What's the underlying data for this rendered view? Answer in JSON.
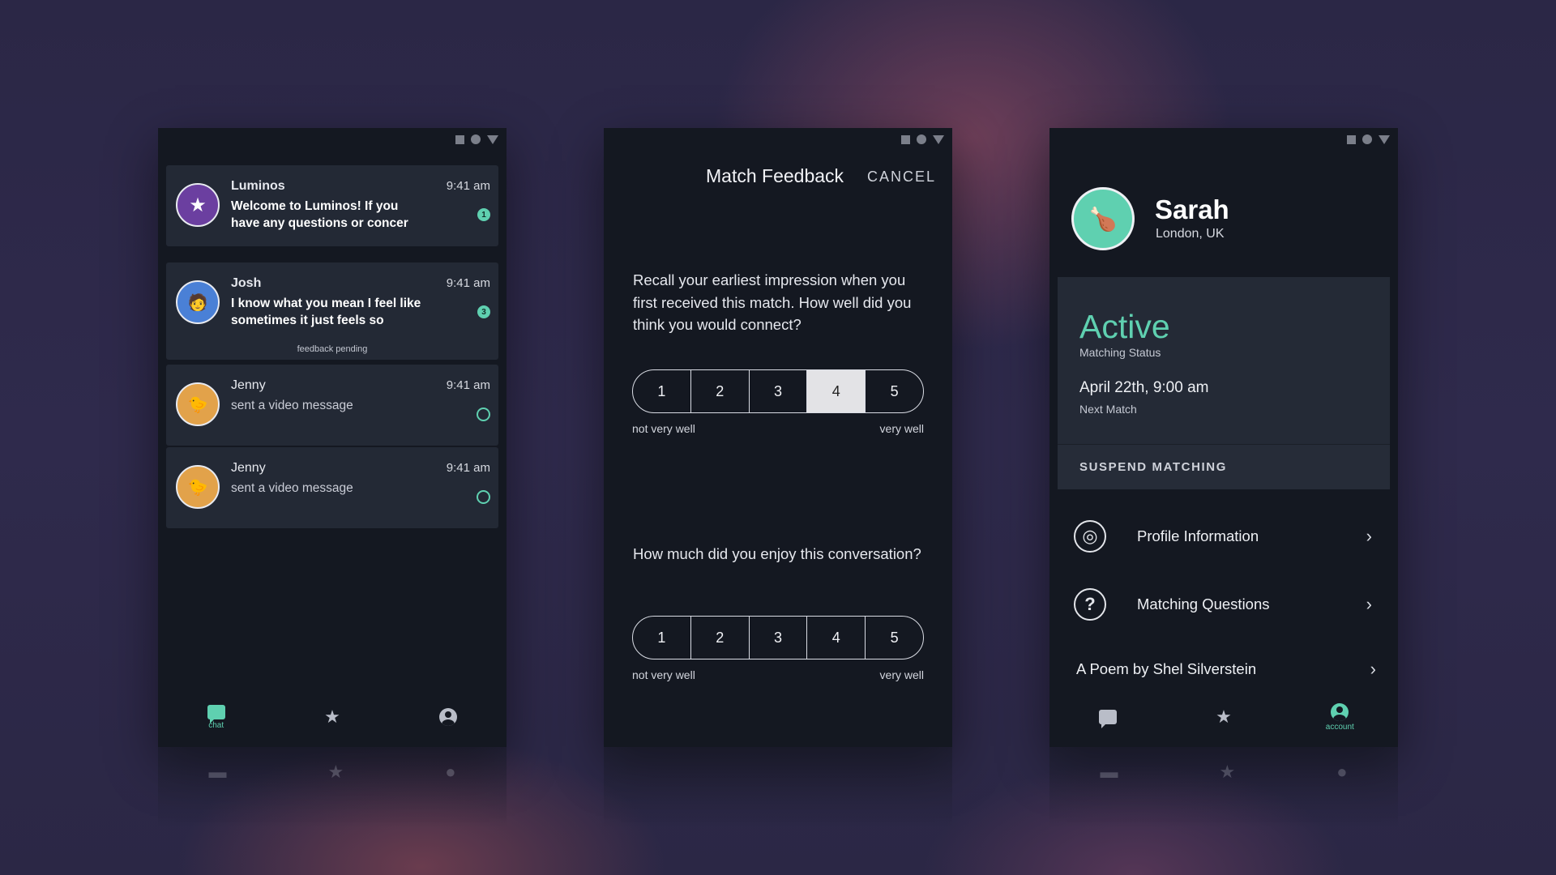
{
  "status_icons": [
    "square-icon",
    "circle-icon",
    "triangle-icon"
  ],
  "colors": {
    "accent": "#5fd0b0",
    "panel": "#141821",
    "card": "#232935",
    "background": "#2d2948"
  },
  "chat_screen": {
    "conversations": [
      {
        "name": "Luminos",
        "time": "9:41 am",
        "message": "Welcome to Luminos! If you have any questions or concer",
        "unread": "1",
        "avatar_icon": "star-icon"
      },
      {
        "name": "Josh",
        "time": "9:41 am",
        "message": "I know what you mean I feel like sometimes it just feels so",
        "unread": "3",
        "footer": "feedback pending",
        "avatar_icon": "avatar-emoji"
      },
      {
        "name": "Jenny",
        "time": "9:41 am",
        "message": "sent a video message",
        "avatar_icon": "avatar-emoji"
      },
      {
        "name": "Jenny",
        "time": "9:41 am",
        "message": "sent a video message",
        "avatar_icon": "avatar-emoji"
      }
    ],
    "nav": {
      "chat_label": "chat",
      "active": "chat"
    }
  },
  "feedback_screen": {
    "title": "Match Feedback",
    "cancel_label": "CANCEL",
    "questions": [
      {
        "text": "Recall your earliest impression when you first received this match. How well did you think you would connect?",
        "options": [
          "1",
          "2",
          "3",
          "4",
          "5"
        ],
        "selected": "4",
        "low_label": "not very well",
        "high_label": "very well"
      },
      {
        "text": "How much did you enjoy this conversation?",
        "options": [
          "1",
          "2",
          "3",
          "4",
          "5"
        ],
        "selected": null,
        "low_label": "not very well",
        "high_label": "very well"
      }
    ]
  },
  "account_screen": {
    "name": "Sarah",
    "location": "London, UK",
    "status": "Active",
    "status_caption": "Matching Status",
    "next_match": "April 22th, 9:00 am",
    "next_match_caption": "Next Match",
    "suspend_label": "SUSPEND MATCHING",
    "menu": [
      {
        "label": "Profile Information",
        "icon": "astronaut-helmet-icon"
      },
      {
        "label": "Matching Questions",
        "icon": "question-icon"
      },
      {
        "label": "A Poem by Shel Silverstein",
        "icon": null
      }
    ],
    "nav": {
      "account_label": "account",
      "active": "account"
    }
  }
}
